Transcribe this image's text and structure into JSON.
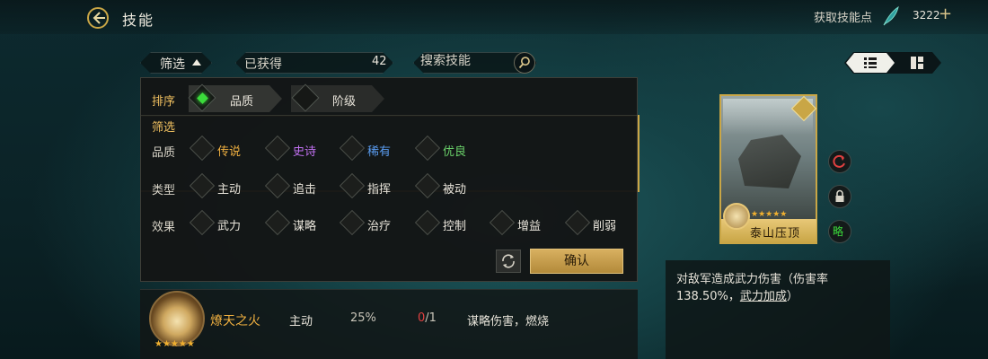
{
  "header": {
    "title": "技能",
    "obtain_points_label": "获取技能点",
    "points_value": "3222",
    "plus_symbol": "+"
  },
  "toolbar": {
    "filter_label": "筛选",
    "obtained_label": "已获得",
    "obtained_count": "42",
    "search_placeholder": "搜索技能"
  },
  "filter_panel": {
    "sort_label": "排序",
    "sort_options": [
      "品质",
      "阶级"
    ],
    "filter_label": "筛选",
    "rows": [
      {
        "label": "品质",
        "options": [
          {
            "text": "传说",
            "color": "#f0b040"
          },
          {
            "text": "史诗",
            "color": "#c070f0"
          },
          {
            "text": "稀有",
            "color": "#5a9cf0"
          },
          {
            "text": "优良",
            "color": "#6ad06a"
          }
        ]
      },
      {
        "label": "类型",
        "options": [
          {
            "text": "主动",
            "color": "#e8e4da"
          },
          {
            "text": "追击",
            "color": "#e8e4da"
          },
          {
            "text": "指挥",
            "color": "#e8e4da"
          },
          {
            "text": "被动",
            "color": "#e8e4da"
          }
        ]
      },
      {
        "label": "效果",
        "options": [
          {
            "text": "武力",
            "color": "#e8e4da"
          },
          {
            "text": "谋略",
            "color": "#e8e4da"
          },
          {
            "text": "治疗",
            "color": "#e8e4da"
          },
          {
            "text": "控制",
            "color": "#e8e4da"
          },
          {
            "text": "增益",
            "color": "#e8e4da"
          },
          {
            "text": "削弱",
            "color": "#e8e4da"
          }
        ]
      }
    ],
    "confirm_label": "确认"
  },
  "skill_row": {
    "name": "燎天之火",
    "stars": "★★★★★",
    "type": "主动",
    "rate": "25%",
    "count_used": "0",
    "count_total": "/1",
    "desc": "谋略伤害，燃烧"
  },
  "card": {
    "name": "泰山压顶",
    "stars": "★★★★★",
    "strategy_glyph": "略"
  },
  "description": {
    "line1": "对敌军造成武力伤害（伤害率",
    "line2_prefix": "138.50%，",
    "line2_link": "武力加成",
    "line2_suffix": "）"
  },
  "icons": [
    "back-arrow-icon",
    "feather-icon",
    "search-icon",
    "list-view-icon",
    "grid-view-icon",
    "refresh-icon",
    "reset-icon",
    "lock-icon",
    "tactic-badge-icon"
  ]
}
